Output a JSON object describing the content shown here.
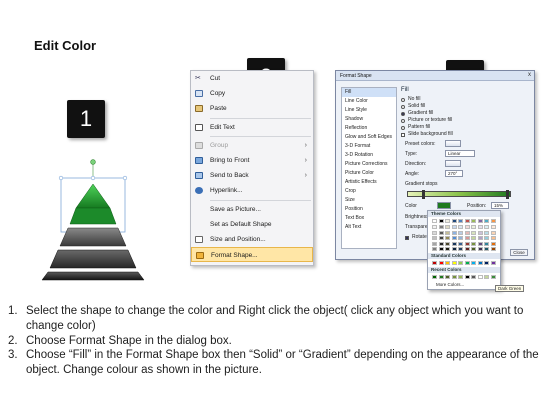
{
  "title": "Edit Color",
  "badges": [
    "1",
    "2",
    "3"
  ],
  "context_menu": {
    "items": [
      {
        "label": "Cut",
        "icon": "scissors-icon",
        "state": "normal",
        "submenu": false
      },
      {
        "label": "Copy",
        "icon": "copy-icon",
        "state": "normal",
        "submenu": false
      },
      {
        "label": "Paste",
        "icon": "paste-icon",
        "state": "normal",
        "submenu": false
      },
      {
        "label": "Edit Text",
        "icon": "edit-text-icon",
        "state": "normal",
        "submenu": false
      },
      {
        "label": "Group",
        "icon": "group-icon",
        "state": "disabled",
        "submenu": true
      },
      {
        "label": "Bring to Front",
        "icon": "bring-front-icon",
        "state": "normal",
        "submenu": true
      },
      {
        "label": "Send to Back",
        "icon": "send-back-icon",
        "state": "normal",
        "submenu": true
      },
      {
        "label": "Hyperlink...",
        "icon": "hyperlink-icon",
        "state": "normal",
        "submenu": false
      },
      {
        "label": "Save as Picture...",
        "icon": "",
        "state": "normal",
        "submenu": false
      },
      {
        "label": "Set as Default Shape",
        "icon": "",
        "state": "normal",
        "submenu": false
      },
      {
        "label": "Size and Position...",
        "icon": "size-icon",
        "state": "normal",
        "submenu": false
      },
      {
        "label": "Format Shape...",
        "icon": "format-shape-icon",
        "state": "selected",
        "submenu": false
      }
    ]
  },
  "dialog": {
    "title": "Format Shape",
    "close": "x",
    "categories": [
      "Fill",
      "Line Color",
      "Line Style",
      "Shadow",
      "Reflection",
      "Glow and Soft Edges",
      "3-D Format",
      "3-D Rotation",
      "Picture Corrections",
      "Picture Color",
      "Artistic Effects",
      "Crop",
      "Size",
      "Position",
      "Text Box",
      "Alt Text"
    ],
    "fill_header": "Fill",
    "fill_options": [
      {
        "label": "No fill",
        "on": false
      },
      {
        "label": "Solid fill",
        "on": false
      },
      {
        "label": "Gradient fill",
        "on": true
      },
      {
        "label": "Picture or texture fill",
        "on": false
      },
      {
        "label": "Pattern fill",
        "on": false
      }
    ],
    "slide_bg": "Slide background fill",
    "preset_label": "Preset colors:",
    "type_label": "Type:",
    "type_value": "Linear",
    "direction_label": "Direction:",
    "angle_label": "Angle:",
    "angle_value": "270°",
    "stops_label": "Gradient stops",
    "color_label": "Color",
    "position_label": "Position:",
    "position_value": "15%",
    "brightness_label": "Brightness:",
    "transparency_label": "Transparency:",
    "rotate_label": "Rotate with shape",
    "close_button": "Close"
  },
  "palette": {
    "theme_header": "Theme Colors",
    "standard_header": "Standard Colors",
    "recent_header": "Recent Colors",
    "more": "More Colors...",
    "tooltip": "Dark Green",
    "theme_top": [
      "#ffffff",
      "#000000",
      "#eeece1",
      "#1f497d",
      "#4f81bd",
      "#c0504d",
      "#9bbb59",
      "#8064a2",
      "#4bacc6",
      "#f79646"
    ],
    "theme_shades": [
      [
        "#f2f2f2",
        "#7f7f7f",
        "#ddd9c3",
        "#c6d9f0",
        "#dbe5f1",
        "#f2dcdb",
        "#ebf1dd",
        "#e5e0ec",
        "#dbeef3",
        "#fdeada"
      ],
      [
        "#d8d8d8",
        "#595959",
        "#c4bd97",
        "#8db3e2",
        "#b8cce4",
        "#e5b9b7",
        "#d7e3bc",
        "#ccc1d9",
        "#b7dde8",
        "#fbd5b5"
      ],
      [
        "#bfbfbf",
        "#3f3f3f",
        "#938953",
        "#548dd4",
        "#95b3d7",
        "#d99694",
        "#c3d69b",
        "#b2a2c7",
        "#92cddc",
        "#fac08f"
      ],
      [
        "#a5a5a5",
        "#262626",
        "#494429",
        "#17365d",
        "#366092",
        "#953734",
        "#76923c",
        "#5f497a",
        "#31859b",
        "#e36c09"
      ],
      [
        "#7f7f7f",
        "#0c0c0c",
        "#1d1b10",
        "#0f243e",
        "#244061",
        "#632423",
        "#4f6128",
        "#3f3151",
        "#205867",
        "#974806"
      ]
    ],
    "standard": [
      "#c00000",
      "#ff0000",
      "#ffc000",
      "#ffff00",
      "#92d050",
      "#00b050",
      "#00b0f0",
      "#0070c0",
      "#002060",
      "#7030a0"
    ],
    "recent": [
      "#006400",
      "#1f7a1f",
      "#4f6128",
      "#76923c",
      "#9bbb59",
      "#000000",
      "#595959",
      "#ffffff",
      "#c3d69b",
      "#3c8d3c"
    ]
  },
  "pyramid": {
    "colors": {
      "top": "#22a032",
      "tiers": [
        "#6d6d6d",
        "#4a4a4a",
        "#2b2b2b"
      ]
    }
  },
  "steps": [
    {
      "num": "1.",
      "text": "Select the shape to change the color and Right click the object( click any object which you want to change color)"
    },
    {
      "num": "2.",
      "text": "Choose Format Shape in the dialog box."
    },
    {
      "num": "3.",
      "text": "Choose “Fill” in the Format Shape box then “Solid” or “Gradient” depending on the appearance of the object. Change colour as shown in the picture."
    }
  ]
}
